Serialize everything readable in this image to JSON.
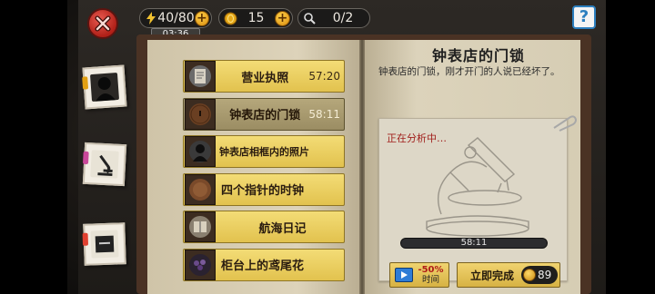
{
  "hud": {
    "energy": "40/80",
    "coins": "15",
    "clues": "0/2",
    "timer": "03:36",
    "icons": {
      "energy": "lightning-icon",
      "coins": "coin-icon",
      "clues": "magnifier-icon",
      "add": "plus-icon",
      "close": "close-icon",
      "help": "help-icon"
    },
    "help_label": "?"
  },
  "list": {
    "items": [
      {
        "label": "营业执照",
        "time": "57:20",
        "icon": "license-icon"
      },
      {
        "label": "钟表店的门锁",
        "time": "58:11",
        "icon": "door-lock-icon"
      },
      {
        "label": "钟表店相框内的照片",
        "time": "",
        "icon": "photo-frame-icon"
      },
      {
        "label": "四个指针的时钟",
        "time": "",
        "icon": "clock-icon"
      },
      {
        "label": "航海日记",
        "time": "",
        "icon": "diary-icon"
      },
      {
        "label": "柜台上的鸢尾花",
        "time": "",
        "icon": "iris-flower-icon"
      }
    ]
  },
  "detail": {
    "title": "钟表店的门锁",
    "description": "钟表店的门锁，刚才开门的人说已经坏了。",
    "status": "正在分析中…",
    "progress_time": "58:11",
    "ad_button": {
      "discount": "-50%",
      "sub": "时间"
    },
    "finish_button": {
      "label": "立即完成",
      "cost": "89"
    }
  },
  "colors": {
    "accent": "#e2c24e",
    "status_red": "#a1201d",
    "help_blue": "#2c7fbf"
  }
}
